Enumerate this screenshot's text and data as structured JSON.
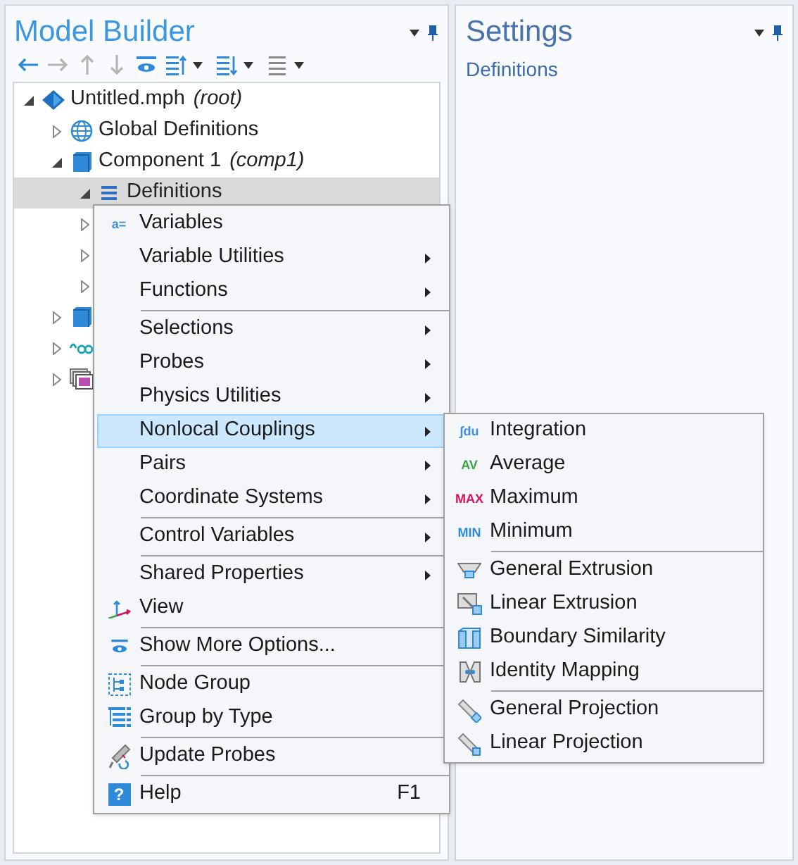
{
  "model_builder": {
    "title": "Model Builder",
    "toolbar": [
      {
        "disabled": false,
        "dropdown": false
      },
      {
        "disabled": true,
        "dropdown": false
      },
      {
        "disabled": true,
        "dropdown": false
      },
      {
        "disabled": true,
        "dropdown": false
      },
      {
        "disabled": false,
        "dropdown": false
      },
      {
        "disabled": false,
        "dropdown": true
      },
      {
        "disabled": false,
        "dropdown": true
      },
      {
        "disabled": true,
        "dropdown": true
      }
    ],
    "tree": [
      {
        "label": "Untitled.mph",
        "note": "(root)",
        "expanded": true,
        "selected": false,
        "children": [
          {
            "label": "Global Definitions",
            "expanded": false,
            "selected": false
          },
          {
            "label": "Component 1",
            "note": "(comp1)",
            "expanded": true,
            "selected": false,
            "children": [
              {
                "label": "Definitions",
                "expanded": true,
                "selected": true
              },
              {
                "expanded": false,
                "selected": false
              },
              {
                "expanded": false,
                "selected": false
              },
              {
                "expanded": false,
                "selected": false
              }
            ]
          },
          {
            "expanded": false,
            "selected": false
          },
          {
            "expanded": false,
            "selected": false
          },
          {
            "expanded": false,
            "selected": false
          }
        ]
      }
    ]
  },
  "settings": {
    "title": "Settings",
    "subtitle": "Definitions"
  },
  "context_menu": {
    "groups": [
      [
        {
          "label": "Variables",
          "badge": "a=",
          "color": "#3d8fd8",
          "submenu": false,
          "selected": false
        },
        {
          "label": "Variable Utilities",
          "submenu": true,
          "selected": false
        },
        {
          "label": "Functions",
          "submenu": true,
          "selected": false
        }
      ],
      [
        {
          "label": "Selections",
          "submenu": true,
          "selected": false
        },
        {
          "label": "Probes",
          "submenu": true,
          "selected": false
        },
        {
          "label": "Physics Utilities",
          "submenu": true,
          "selected": false
        },
        {
          "label": "Nonlocal Couplings",
          "submenu": true,
          "selected": true
        },
        {
          "label": "Pairs",
          "submenu": true,
          "selected": false
        },
        {
          "label": "Coordinate Systems",
          "submenu": true,
          "selected": false
        }
      ],
      [
        {
          "label": "Control Variables",
          "submenu": true,
          "selected": false
        }
      ],
      [
        {
          "label": "Shared Properties",
          "submenu": true,
          "selected": false
        },
        {
          "label": "View",
          "submenu": false,
          "selected": false
        }
      ],
      [
        {
          "label": "Show More Options...",
          "submenu": false,
          "selected": false
        }
      ],
      [
        {
          "label": "Node Group",
          "submenu": false,
          "selected": false
        },
        {
          "label": "Group by Type",
          "submenu": false,
          "selected": false
        }
      ],
      [
        {
          "label": "Update Probes",
          "submenu": false,
          "selected": false
        }
      ],
      [
        {
          "label": "Help",
          "badge": "?",
          "color": "#2e8ad8",
          "shortcut": "F1",
          "submenu": false,
          "selected": false
        }
      ]
    ]
  },
  "submenu": {
    "groups": [
      [
        {
          "label": "Integration",
          "badge": "∫du",
          "color": "#3d8fd8",
          "selected": false
        },
        {
          "label": "Average",
          "badge": "AV",
          "color": "#3aa640",
          "selected": false
        },
        {
          "label": "Maximum",
          "badge": "MAX",
          "color": "#d4145a",
          "selected": false
        },
        {
          "label": "Minimum",
          "badge": "MIN",
          "color": "#2e8ad8",
          "selected": false
        }
      ],
      [
        {
          "label": "General Extrusion",
          "selected": false
        },
        {
          "label": "Linear Extrusion",
          "selected": false
        },
        {
          "label": "Boundary Similarity",
          "selected": false
        },
        {
          "label": "Identity Mapping",
          "selected": false
        }
      ],
      [
        {
          "label": "General Projection",
          "selected": false
        },
        {
          "label": "Linear Projection",
          "selected": false
        }
      ]
    ]
  }
}
